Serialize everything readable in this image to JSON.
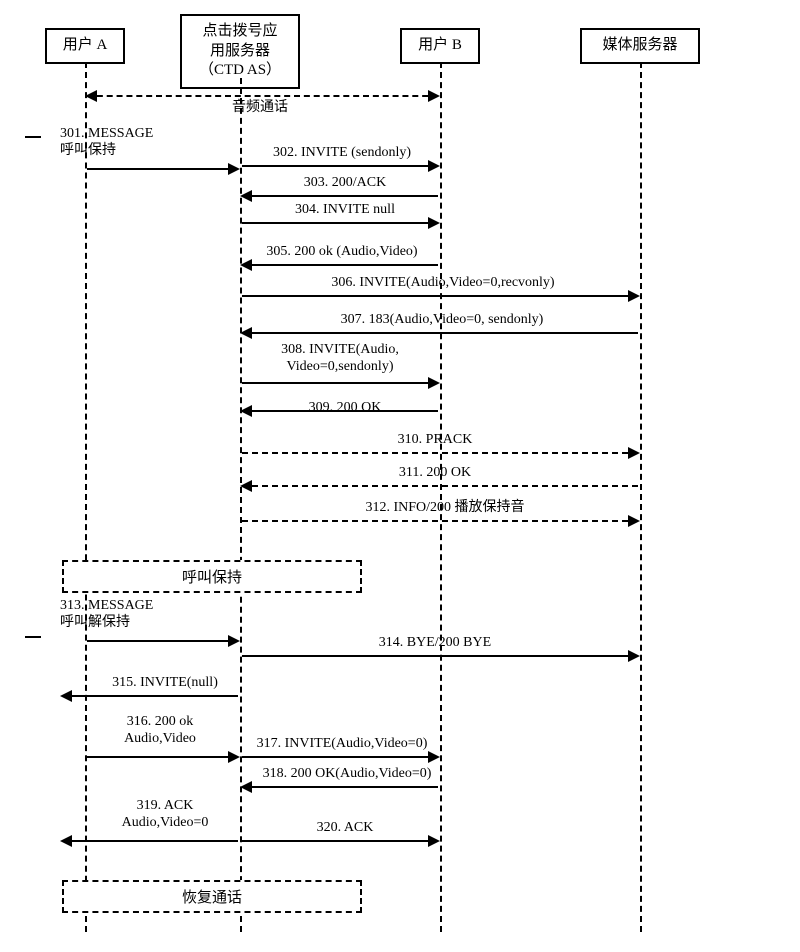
{
  "actors": {
    "a": "用户 A",
    "ctd_l1": "点击拨号应",
    "ctd_l2": "用服务器",
    "ctd_l3": "（CTD AS）",
    "b": "用户 B",
    "media": "媒体服务器"
  },
  "notes": {
    "audio_call": "音频通话",
    "hold": "呼叫保持",
    "resume": "恢复通话"
  },
  "msgs": {
    "m301_l1": "301. MESSAGE",
    "m301_l2": "呼叫保持",
    "m302": "302. INVITE  (sendonly)",
    "m303": "303. 200/ACK",
    "m304": "304. INVITE null",
    "m305": "305. 200 ok (Audio,Video)",
    "m306": "306. INVITE(Audio,Video=0,recvonly)",
    "m307": "307. 183(Audio,Video=0, sendonly)",
    "m308_l1": "308. INVITE(Audio,",
    "m308_l2": "Video=0,sendonly)",
    "m309": "309. 200 OK",
    "m310": "310. PRACK",
    "m311": "311. 200 OK",
    "m312": "312. INFO/200 播放保持音",
    "m313_l1": "313. MESSAGE",
    "m313_l2": "呼叫解保持",
    "m314": "314. BYE/200 BYE",
    "m315": "315. INVITE(null)",
    "m316_l1": "316. 200 ok",
    "m316_l2": "Audio,Video",
    "m317": "317. INVITE(Audio,Video=0)",
    "m318": "318. 200 OK(Audio,Video=0)",
    "m319_l1": "319. ACK",
    "m319_l2": "Audio,Video=0",
    "m320": "320. ACK"
  },
  "chart_data": {
    "type": "sequence-diagram",
    "actors": [
      "用户 A",
      "点击拨号应用服务器（CTD AS）",
      "用户 B",
      "媒体服务器"
    ],
    "messages": [
      {
        "id": "note",
        "text": "音频通话",
        "from": "用户 A",
        "to": "用户 B",
        "style": "dashed-span"
      },
      {
        "id": "301",
        "text": "MESSAGE 呼叫保持",
        "from": "用户 A",
        "to": "CTD AS",
        "dir": "right"
      },
      {
        "id": "302",
        "text": "INVITE (sendonly)",
        "from": "CTD AS",
        "to": "用户 B",
        "dir": "right"
      },
      {
        "id": "303",
        "text": "200/ACK",
        "from": "用户 B",
        "to": "CTD AS",
        "dir": "left"
      },
      {
        "id": "304",
        "text": "INVITE null",
        "from": "CTD AS",
        "to": "用户 B",
        "dir": "right"
      },
      {
        "id": "305",
        "text": "200 ok (Audio,Video)",
        "from": "用户 B",
        "to": "CTD AS",
        "dir": "left"
      },
      {
        "id": "306",
        "text": "INVITE(Audio,Video=0,recvonly)",
        "from": "CTD AS",
        "to": "媒体服务器",
        "dir": "right"
      },
      {
        "id": "307",
        "text": "183(Audio,Video=0, sendonly)",
        "from": "媒体服务器",
        "to": "CTD AS",
        "dir": "left"
      },
      {
        "id": "308",
        "text": "INVITE(Audio, Video=0,sendonly)",
        "from": "CTD AS",
        "to": "用户 B",
        "dir": "right"
      },
      {
        "id": "309",
        "text": "200 OK",
        "from": "用户 B",
        "to": "CTD AS",
        "dir": "left"
      },
      {
        "id": "310",
        "text": "PRACK",
        "from": "CTD AS",
        "to": "媒体服务器",
        "dir": "right",
        "style": "dashed"
      },
      {
        "id": "311",
        "text": "200 OK",
        "from": "媒体服务器",
        "to": "CTD AS",
        "dir": "left",
        "style": "dashed"
      },
      {
        "id": "312",
        "text": "INFO/200 播放保持音",
        "from": "CTD AS",
        "to": "媒体服务器",
        "dir": "right",
        "style": "dashed"
      },
      {
        "id": "note",
        "text": "呼叫保持",
        "span": "left-region",
        "style": "dashed-box"
      },
      {
        "id": "313",
        "text": "MESSAGE 呼叫解保持",
        "from": "用户 A",
        "to": "CTD AS",
        "dir": "right"
      },
      {
        "id": "314",
        "text": "BYE/200 BYE",
        "from": "CTD AS",
        "to": "媒体服务器",
        "dir": "right"
      },
      {
        "id": "315",
        "text": "INVITE(null)",
        "from": "CTD AS",
        "to": "用户 A",
        "dir": "left"
      },
      {
        "id": "316",
        "text": "200 ok Audio,Video",
        "from": "用户 A",
        "to": "CTD AS",
        "dir": "right"
      },
      {
        "id": "317",
        "text": "INVITE(Audio,Video=0)",
        "from": "CTD AS",
        "to": "用户 B",
        "dir": "right"
      },
      {
        "id": "318",
        "text": "200 OK(Audio,Video=0)",
        "from": "用户 B",
        "to": "CTD AS",
        "dir": "left"
      },
      {
        "id": "319",
        "text": "ACK Audio,Video=0",
        "from": "CTD AS",
        "to": "用户 A",
        "dir": "left"
      },
      {
        "id": "320",
        "text": "ACK",
        "from": "CTD AS",
        "to": "用户 B",
        "dir": "right"
      },
      {
        "id": "note",
        "text": "恢复通话",
        "span": "left-region",
        "style": "dashed-box"
      }
    ]
  }
}
